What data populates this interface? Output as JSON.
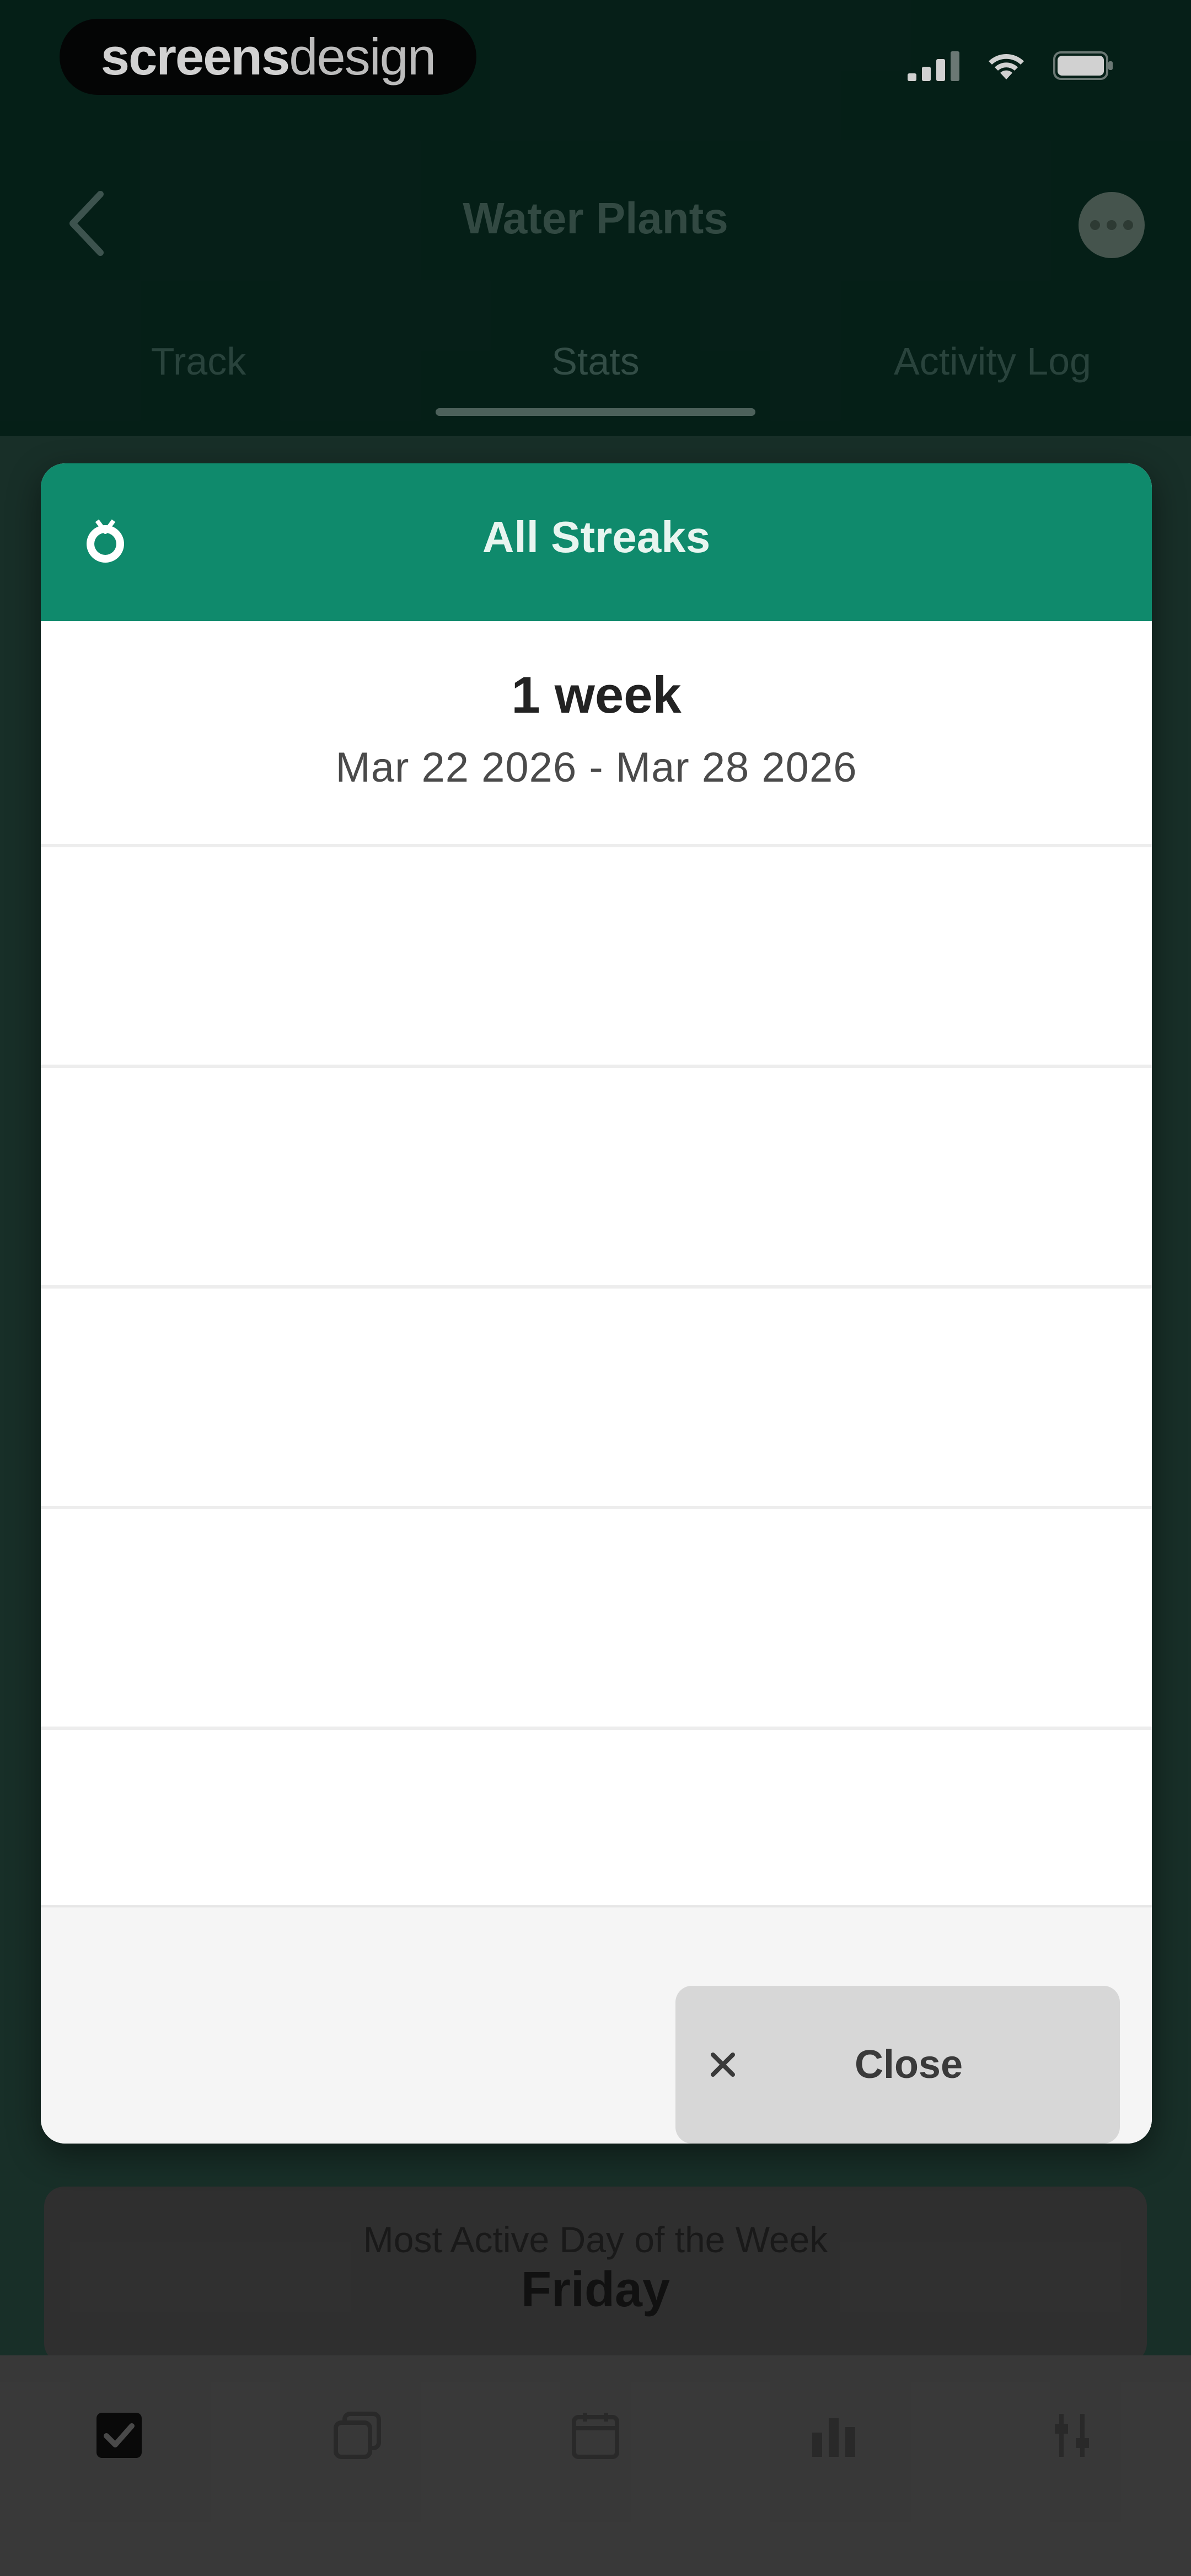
{
  "status_bar": {
    "brand_bold": "screens",
    "brand_light": "design"
  },
  "header": {
    "title": "Water Plants"
  },
  "tabs": [
    {
      "label": "Track",
      "active": false
    },
    {
      "label": "Stats",
      "active": true
    },
    {
      "label": "Activity Log",
      "active": false
    }
  ],
  "modal": {
    "title": "All Streaks",
    "streaks": [
      {
        "duration": "1 week",
        "range": "Mar 22 2026 - Mar 28 2026"
      }
    ],
    "close_label": "Close"
  },
  "stats_card": {
    "label": "Most Active Day of the Week",
    "value": "Friday"
  },
  "bottom_nav": [
    {
      "icon": "checkbox-icon",
      "active": true
    },
    {
      "icon": "copy-icon",
      "active": false
    },
    {
      "icon": "calendar-icon",
      "active": false
    },
    {
      "icon": "stats-icon",
      "active": false
    },
    {
      "icon": "settings-icon",
      "active": false
    }
  ],
  "colors": {
    "header_bg": "#07261d",
    "modal_header": "#0f8a6c",
    "close_button_bg": "#d7d7d7"
  }
}
